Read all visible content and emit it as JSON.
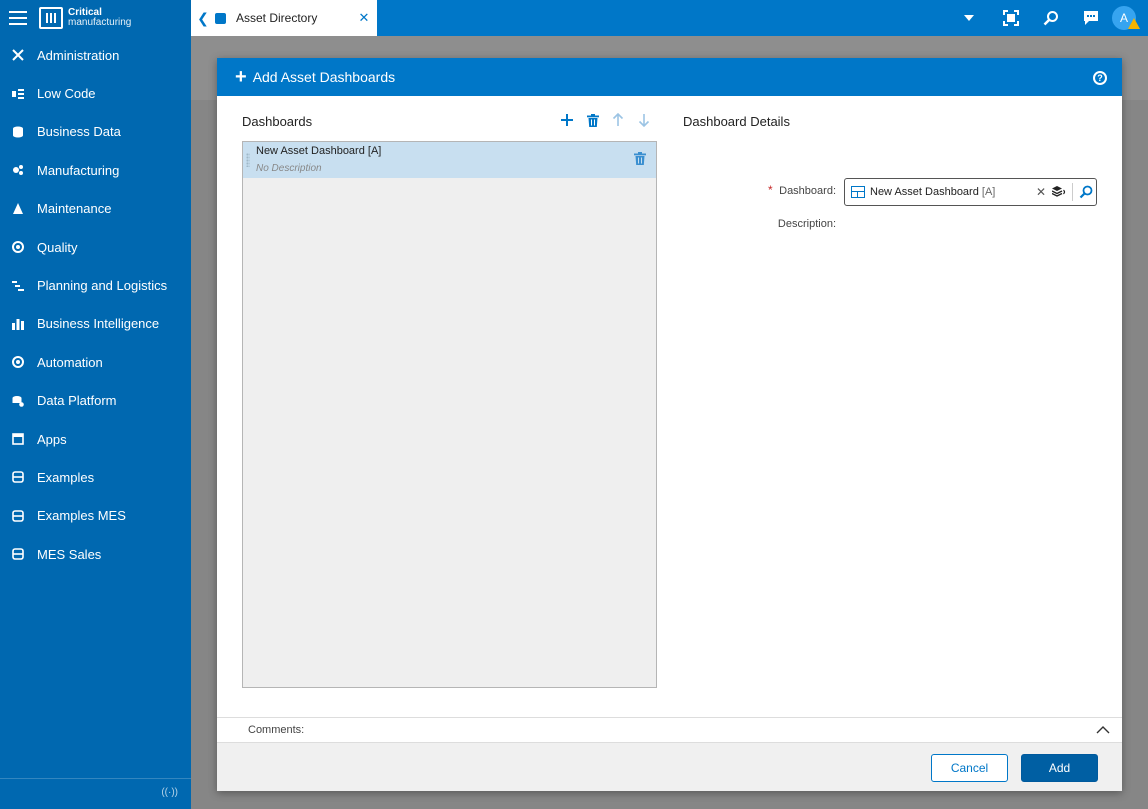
{
  "brand": {
    "line1": "Critical",
    "line2": "manufacturing"
  },
  "sidebar": {
    "items": [
      {
        "label": "Administration",
        "icon": "tools-icon"
      },
      {
        "label": "Low Code",
        "icon": "low-code-icon"
      },
      {
        "label": "Business Data",
        "icon": "database-icon"
      },
      {
        "label": "Manufacturing",
        "icon": "manufacturing-icon"
      },
      {
        "label": "Maintenance",
        "icon": "maintenance-icon"
      },
      {
        "label": "Quality",
        "icon": "quality-icon"
      },
      {
        "label": "Planning and Logistics",
        "icon": "planning-icon"
      },
      {
        "label": "Business Intelligence",
        "icon": "bar-chart-icon"
      },
      {
        "label": "Automation",
        "icon": "automation-icon"
      },
      {
        "label": "Data Platform",
        "icon": "data-platform-icon"
      },
      {
        "label": "Apps",
        "icon": "apps-window-icon"
      },
      {
        "label": "Examples",
        "icon": "examples-icon"
      },
      {
        "label": "Examples MES",
        "icon": "examples-icon"
      },
      {
        "label": "MES Sales",
        "icon": "examples-icon"
      }
    ]
  },
  "topbar": {
    "tab_label": "Asset Directory",
    "avatar_initial": "A"
  },
  "modal": {
    "title": "Add Asset Dashboards",
    "left_title": "Dashboards",
    "right_title": "Dashboard Details",
    "list": [
      {
        "name": "New Asset Dashboard [A]",
        "description": "No Description"
      }
    ],
    "fields": {
      "required_mark": "*",
      "dashboard_label": "Dashboard:",
      "dashboard_value": "New Asset Dashboard",
      "dashboard_tag": "[A]",
      "description_label": "Description:"
    },
    "comments_label": "Comments:",
    "cancel_label": "Cancel",
    "add_label": "Add"
  },
  "colors": {
    "primary": "#0077c8",
    "sidebar": "#0068b0",
    "selected_row": "#c8dff0"
  }
}
